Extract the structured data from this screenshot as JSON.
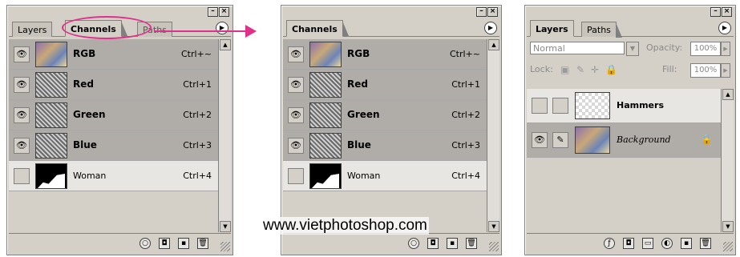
{
  "palette_left": {
    "tabs": [
      "Layers",
      "Channels",
      "Paths"
    ],
    "menu_icon": "palette-menu-icon",
    "channels": [
      {
        "name": "RGB",
        "shortcut": "Ctrl+~",
        "visible": true,
        "thumb": "color"
      },
      {
        "name": "Red",
        "shortcut": "Ctrl+1",
        "visible": true,
        "thumb": "gray"
      },
      {
        "name": "Green",
        "shortcut": "Ctrl+2",
        "visible": true,
        "thumb": "gray"
      },
      {
        "name": "Blue",
        "shortcut": "Ctrl+3",
        "visible": true,
        "thumb": "gray"
      },
      {
        "name": "Woman",
        "shortcut": "Ctrl+4",
        "visible": false,
        "thumb": "mask"
      }
    ],
    "highlight_color": "#e0308a"
  },
  "palette_middle": {
    "tabs": [
      "Channels"
    ],
    "channels": [
      {
        "name": "RGB",
        "shortcut": "Ctrl+~",
        "visible": true,
        "thumb": "color"
      },
      {
        "name": "Red",
        "shortcut": "Ctrl+1",
        "visible": true,
        "thumb": "gray"
      },
      {
        "name": "Green",
        "shortcut": "Ctrl+2",
        "visible": true,
        "thumb": "gray"
      },
      {
        "name": "Blue",
        "shortcut": "Ctrl+3",
        "visible": true,
        "thumb": "gray"
      },
      {
        "name": "Woman",
        "shortcut": "Ctrl+4",
        "visible": false,
        "thumb": "mask"
      }
    ]
  },
  "palette_right": {
    "tabs": [
      "Layers",
      "Paths"
    ],
    "blend_mode": "Normal",
    "opacity_label": "Opacity:",
    "opacity_value": "100%",
    "lock_label": "Lock:",
    "fill_label": "Fill:",
    "fill_value": "100%",
    "layers": [
      {
        "name": "Hammers",
        "visible": false,
        "thumb": "checker"
      },
      {
        "name": "Background",
        "visible": true,
        "thumb": "photo",
        "locked": true
      }
    ]
  },
  "watermark": "www.vietphotoshop.com"
}
